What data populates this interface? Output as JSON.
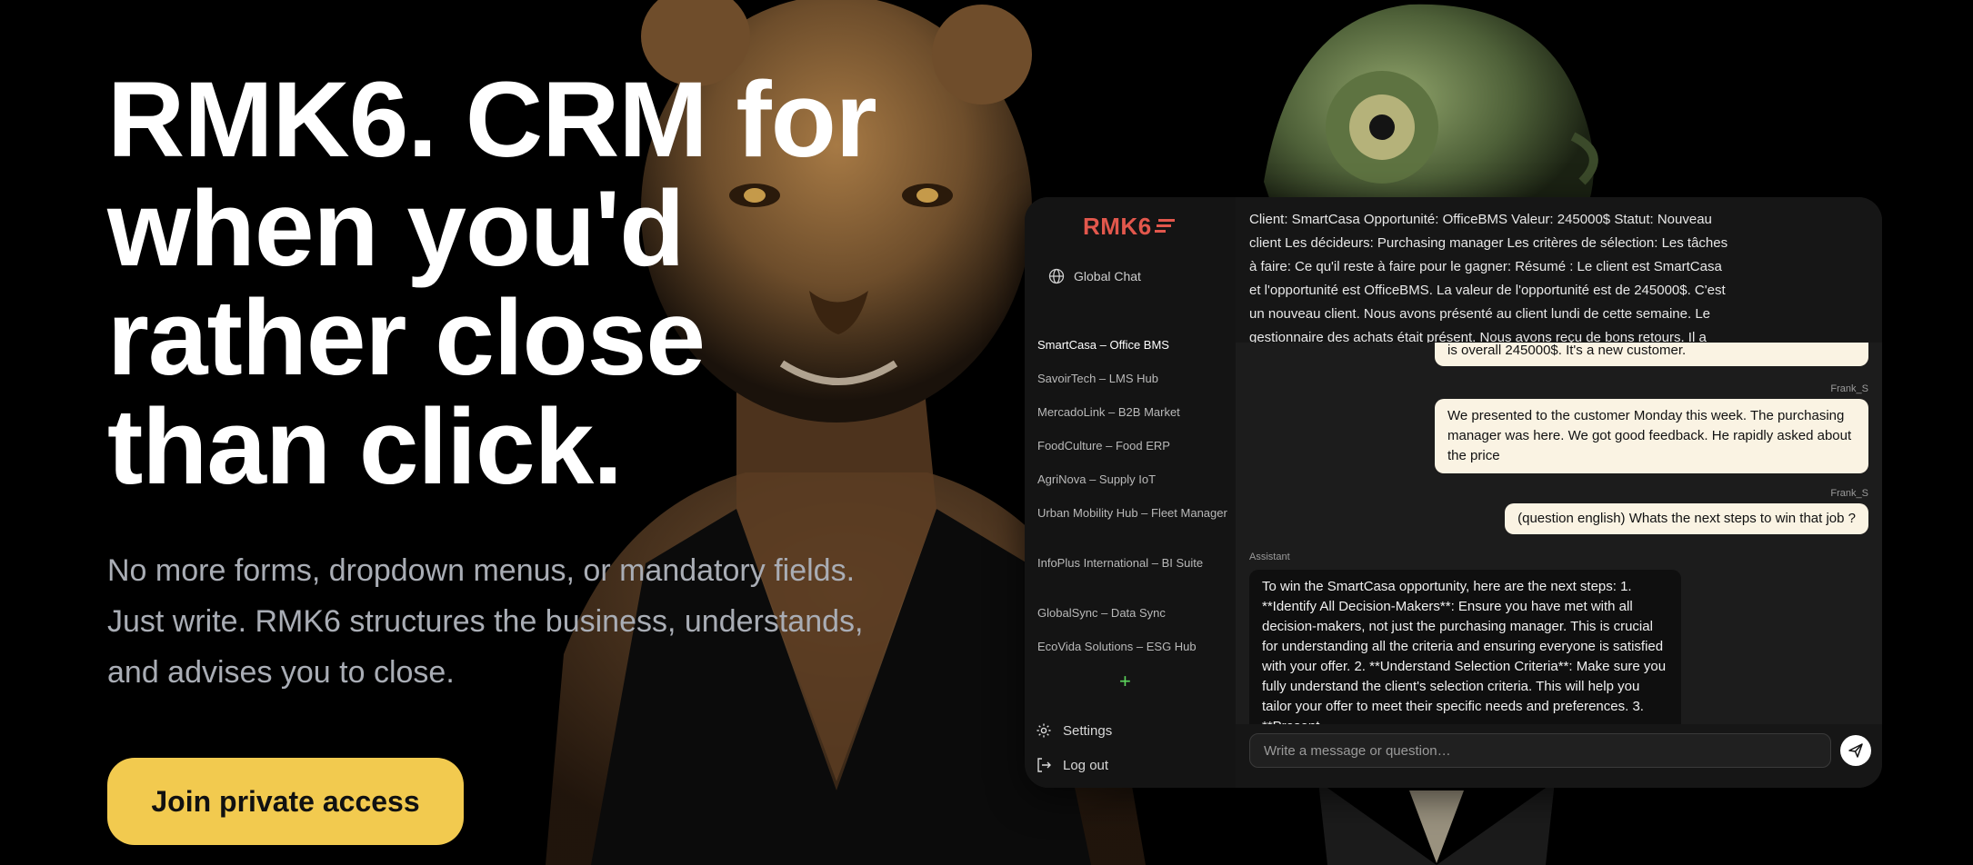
{
  "hero": {
    "title_lines": [
      "RMK6. CRM for",
      "when you'd",
      "rather close",
      "than click."
    ],
    "subtitle_lines": [
      "No more forms, dropdown menus, or mandatory fields.",
      "Just write. RMK6 structures the business, understands,",
      "and advises you to close."
    ],
    "cta_label": "Join private access"
  },
  "app": {
    "logo_text": "RMK6",
    "brand_color": "#e2574c",
    "sidebar": {
      "global_chat_label": "Global Chat",
      "projects": [
        "SmartCasa – Office BMS",
        "SavoirTech – LMS Hub",
        "MercadoLink – B2B Market",
        "FoodCulture – Food ERP",
        "AgriNova – Supply IoT",
        "Urban Mobility Hub – Fleet Manager",
        "InfoPlus International – BI Suite",
        "GlobalSync – Data Sync",
        "EcoVida Solutions – ESG Hub"
      ],
      "active_project_index": 0,
      "add_label": "+",
      "settings_label": "Settings",
      "logout_label": "Log out"
    },
    "summary_text": "Client: SmartCasa Opportunité: OfficeBMS Valeur: 245000$ Statut: Nouveau client Les décideurs: Purchasing manager Les critères de sélection: Les tâches à faire: Ce qu'il reste à faire pour le gagner: Résumé : Le client est SmartCasa et l'opportunité est OfficeBMS. La valeur de l'opportunité est de 245000$. C'est un nouveau client. Nous avons présenté au client lundi de cette semaine. Le gestionnaire des achats était présent. Nous avons reçu de bons retours. Il a",
    "messages": {
      "partial_user": "is overall 245000$. It's a new customer.",
      "sender1": "Frank_S",
      "user1": "We presented to the customer Monday this week. The purchasing manager was here. We got good feedback. He rapidly asked about the price",
      "sender2": "Frank_S",
      "user2": "(question english) Whats the next steps to win that job ?",
      "assistant_label": "Assistant",
      "assistant1": "To win the SmartCasa opportunity, here are the next steps: 1. **Identify All Decision-Makers**: Ensure you have met with all decision-makers, not just the purchasing manager. This is crucial for understanding all the criteria and ensuring everyone is satisfied with your offer. 2. **Understand Selection Criteria**: Make sure you fully understand the client's selection criteria. This will help you tailor your offer to meet their specific needs and preferences. 3. **Present"
    },
    "composer_placeholder": "Write a message or question…"
  }
}
